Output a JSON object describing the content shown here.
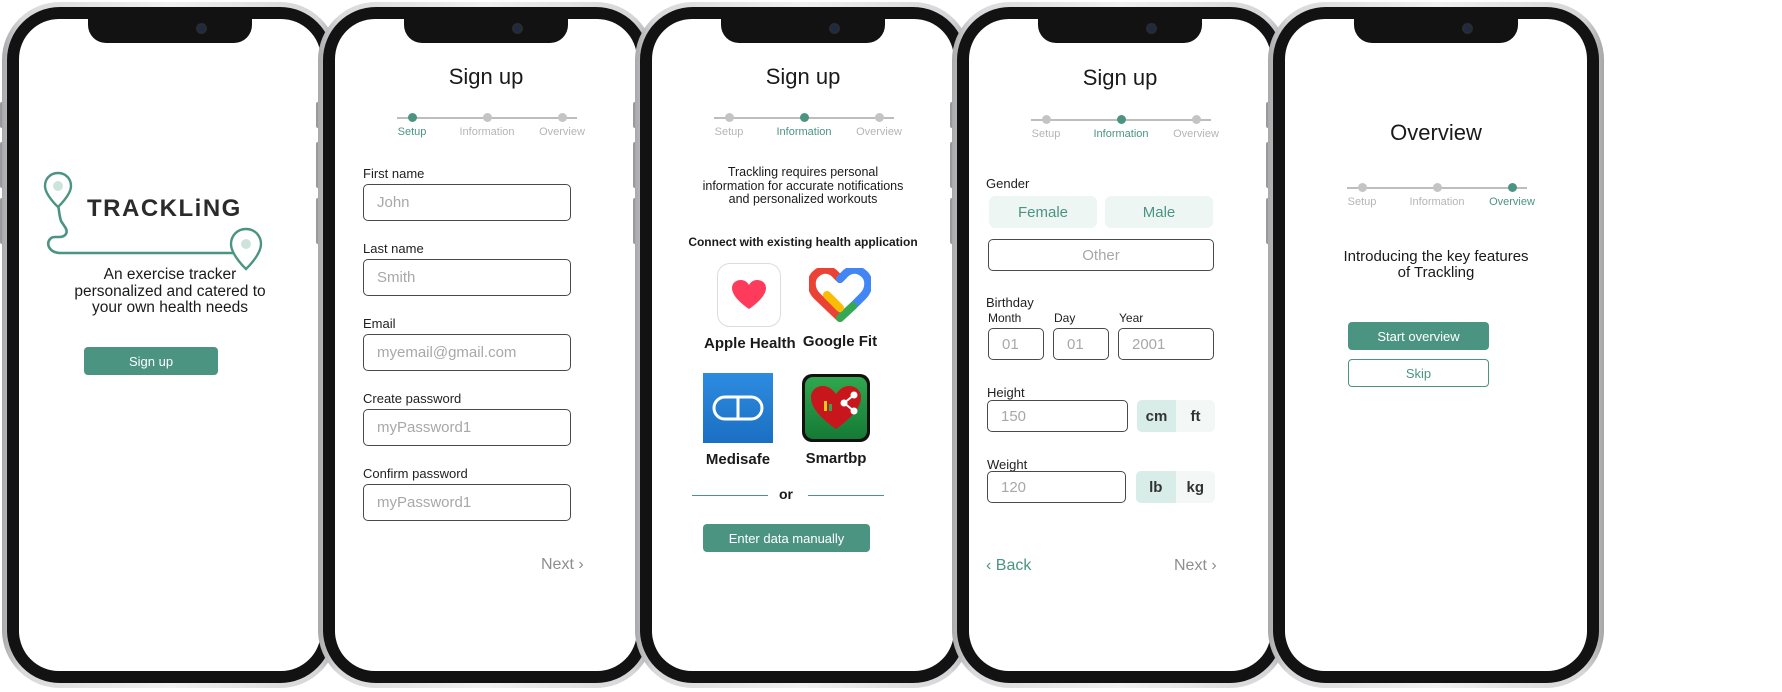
{
  "colors": {
    "accent": "#4c9482",
    "muted": "#b5b5b5",
    "pill_bg": "#eef6f4"
  },
  "steps": [
    "Setup",
    "Information",
    "Overview"
  ],
  "screen1": {
    "logo_text": "TRACKLiNG",
    "tagline_line1": "An exercise tracker",
    "tagline_line2": "personalized and catered to",
    "tagline_line3": "your own health needs",
    "signup_button": "Sign up"
  },
  "screen2": {
    "title": "Sign up",
    "fields": [
      {
        "label": "First name",
        "placeholder": "John"
      },
      {
        "label": "Last name",
        "placeholder": "Smith"
      },
      {
        "label": "Email",
        "placeholder": "myemail@gmail.com"
      },
      {
        "label": "Create password",
        "placeholder": "myPassword1"
      },
      {
        "label": "Confirm password",
        "placeholder": "myPassword1"
      }
    ],
    "next": "Next ›"
  },
  "screen3": {
    "title": "Sign up",
    "intro_line1": "Trackling requires personal",
    "intro_line2": "information for accurate notifications",
    "intro_line3": "and personalized workouts",
    "connect_heading": "Connect with existing health application",
    "apps": [
      {
        "name": "Apple Health",
        "icon": "apple-health-icon"
      },
      {
        "name": "Google Fit",
        "icon": "google-fit-icon"
      },
      {
        "name": "Medisafe",
        "icon": "medisafe-icon"
      },
      {
        "name": "Smartbp",
        "icon": "smartbp-icon"
      }
    ],
    "or_text": "or",
    "manual_button": "Enter data manually"
  },
  "screen4": {
    "title": "Sign up",
    "gender_label": "Gender",
    "gender_options": [
      "Female",
      "Male",
      "Other"
    ],
    "birthday_label": "Birthday",
    "month_label": "Month",
    "month_placeholder": "01",
    "day_label": "Day",
    "day_placeholder": "01",
    "year_label": "Year",
    "year_placeholder": "2001",
    "height_label": "Height",
    "height_placeholder": "150",
    "height_units": [
      "cm",
      "ft"
    ],
    "weight_label": "Weight",
    "weight_placeholder": "120",
    "weight_units": [
      "lb",
      "kg"
    ],
    "back": "‹ Back",
    "next": "Next ›"
  },
  "screen5": {
    "title": "Overview",
    "intro_line1": "Introducing the key features",
    "intro_line2": "of Trackling",
    "start_button": "Start overview",
    "skip_button": "Skip"
  }
}
